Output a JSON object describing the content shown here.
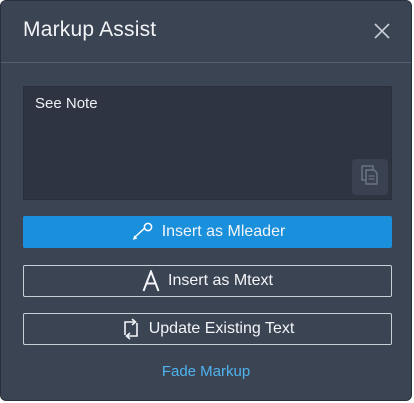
{
  "dialog": {
    "title": "Markup Assist",
    "close_icon": "close-icon"
  },
  "note": {
    "value": "See Note",
    "copy_icon": "copy-icon"
  },
  "buttons": {
    "insert_mleader": {
      "label": "Insert as Mleader",
      "icon": "mleader-icon"
    },
    "insert_mtext": {
      "label": "Insert as Mtext",
      "icon": "mtext-icon"
    },
    "update_text": {
      "label": "Update Existing Text",
      "icon": "update-icon"
    }
  },
  "link": {
    "fade_markup": "Fade Markup"
  },
  "colors": {
    "panel_bg": "#3b4453",
    "textarea_bg": "#2e3441",
    "primary": "#1a8fdb",
    "link": "#4fb3ef"
  }
}
